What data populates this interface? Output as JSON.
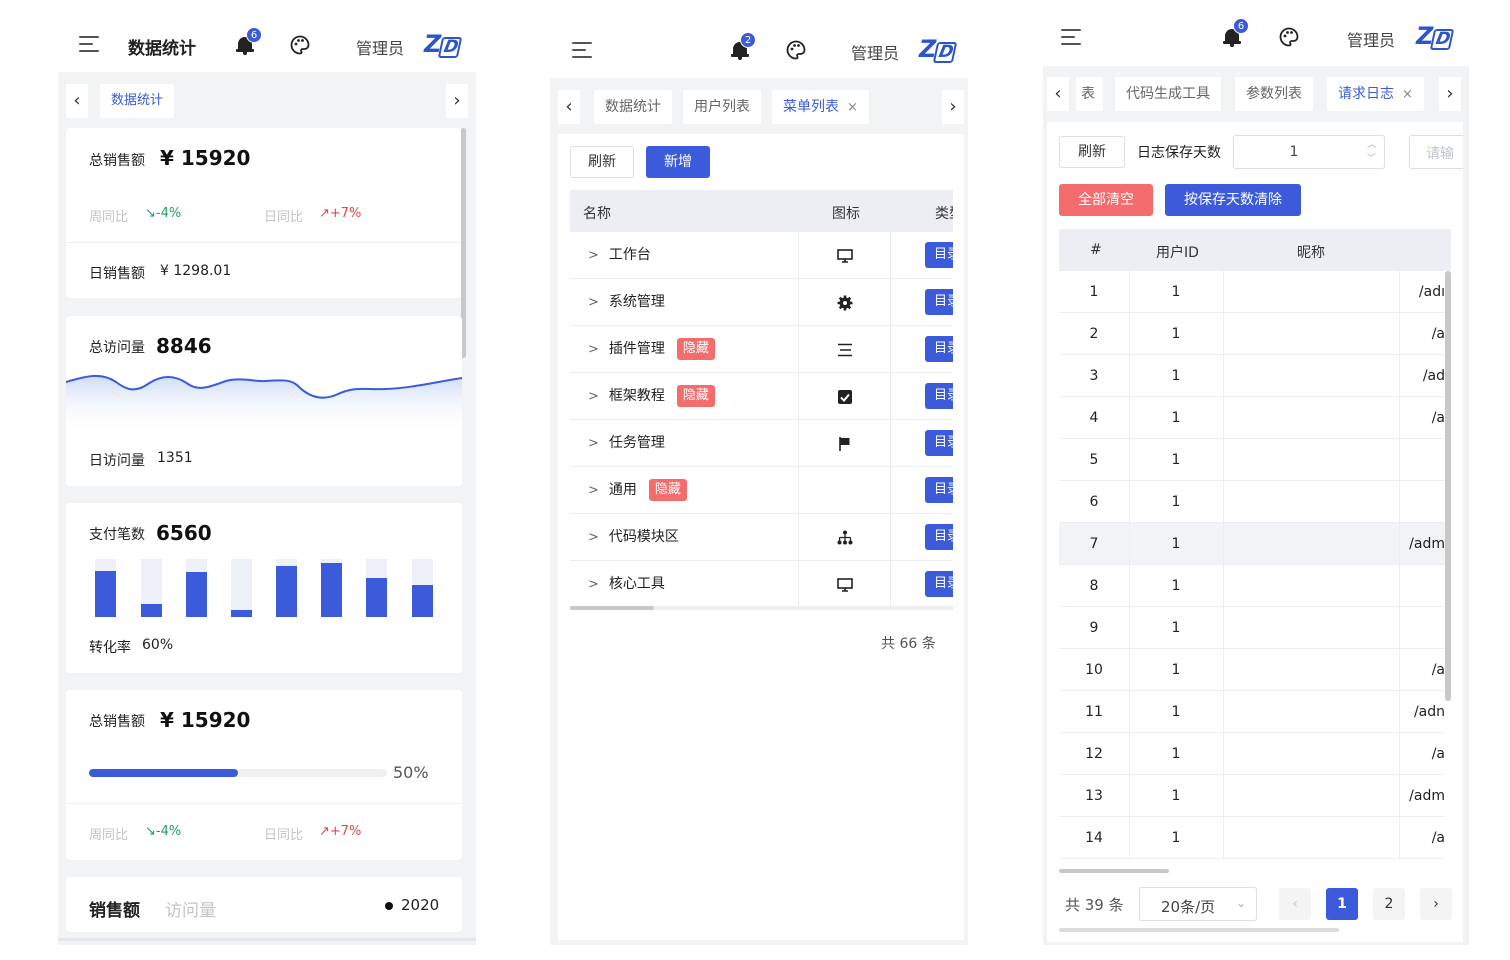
{
  "screen1": {
    "header": {
      "title": "数据统计",
      "badge": "6",
      "admin": "管理员",
      "logo": "Z",
      "logo_box": "D"
    },
    "tabs": {
      "left": "‹",
      "right": "›",
      "active": "数据统计"
    },
    "card1": {
      "label": "总销售额",
      "value": "¥ 15920",
      "wow_label": "周同比",
      "wow_value": "↘-4%",
      "dod_label": "日同比",
      "dod_value": "↗+7%",
      "daily_label": "日销售额",
      "daily_value": "¥ 1298.01"
    },
    "card2": {
      "label": "总访问量",
      "value": "8846",
      "daily_label": "日访问量",
      "daily_value": "1351"
    },
    "card3": {
      "label": "支付笔数",
      "value": "6560",
      "rate_label": "转化率",
      "rate_value": "60%",
      "bars": [
        0.8,
        0.22,
        0.78,
        0.12,
        0.88,
        0.93,
        0.68,
        0.55
      ]
    },
    "card4": {
      "label": "总销售额",
      "value": "¥ 15920",
      "progress": 0.5,
      "progress_text": "50%",
      "wow_label": "周同比",
      "wow_value": "↘-4%",
      "dod_label": "日同比",
      "dod_value": "↗+7%"
    },
    "card5": {
      "tab_sales": "销售额",
      "tab_visits": "访问量",
      "year": "2020"
    }
  },
  "screen2": {
    "header": {
      "badge": "2",
      "admin": "管理员",
      "logo": "Z",
      "logo_box": "D"
    },
    "tabs": {
      "left": "‹",
      "right": "›",
      "items": [
        "数据统计",
        "用户列表",
        "菜单列表"
      ],
      "close": "×"
    },
    "toolbar": {
      "refresh": "刷新",
      "add": "新增"
    },
    "table": {
      "headers": {
        "name": "名称",
        "icon": "图标",
        "type": "类型"
      },
      "hidden_tag": "隐藏",
      "type_tag": "目录",
      "rows": [
        {
          "name": "工作台",
          "icon": "monitor-icon",
          "hidden": false
        },
        {
          "name": "系统管理",
          "icon": "gear-icon",
          "hidden": false
        },
        {
          "name": "插件管理",
          "icon": "list-icon",
          "hidden": true
        },
        {
          "name": "框架教程",
          "icon": "checkbox-icon",
          "hidden": true
        },
        {
          "name": "任务管理",
          "icon": "flag-icon",
          "hidden": false
        },
        {
          "name": "通用",
          "icon": "",
          "hidden": true
        },
        {
          "name": "代码模块区",
          "icon": "sitemap-icon",
          "hidden": false
        },
        {
          "name": "核心工具",
          "icon": "monitor-icon",
          "hidden": false
        }
      ]
    },
    "total": "共 66 条"
  },
  "screen3": {
    "header": {
      "badge": "6",
      "admin": "管理员",
      "logo": "Z",
      "logo_box": "D"
    },
    "tabs": {
      "left": "‹",
      "right": "›",
      "items": [
        "表",
        "代码生成工具",
        "参数列表",
        "请求日志"
      ],
      "close": "×"
    },
    "toolbar": {
      "refresh": "刷新",
      "days_label": "日志保存天数",
      "days_value": "1",
      "placeholder_cut": "请输",
      "clear_all": "全部清空",
      "clear_by_days": "按保存天数清除"
    },
    "table": {
      "headers": {
        "index": "#",
        "user_id": "用户ID",
        "nickname": "昵称"
      },
      "rows": [
        {
          "i": "1",
          "uid": "1",
          "path": "/adı"
        },
        {
          "i": "2",
          "uid": "1",
          "path": "/a"
        },
        {
          "i": "3",
          "uid": "1",
          "path": "/ad"
        },
        {
          "i": "4",
          "uid": "1",
          "path": "/a"
        },
        {
          "i": "5",
          "uid": "1",
          "path": ""
        },
        {
          "i": "6",
          "uid": "1",
          "path": ""
        },
        {
          "i": "7",
          "uid": "1",
          "path": "/adm"
        },
        {
          "i": "8",
          "uid": "1",
          "path": ""
        },
        {
          "i": "9",
          "uid": "1",
          "path": ""
        },
        {
          "i": "10",
          "uid": "1",
          "path": "/a"
        },
        {
          "i": "11",
          "uid": "1",
          "path": "/adn"
        },
        {
          "i": "12",
          "uid": "1",
          "path": "/a"
        },
        {
          "i": "13",
          "uid": "1",
          "path": "/adm"
        },
        {
          "i": "14",
          "uid": "1",
          "path": "/a"
        }
      ]
    },
    "pagination": {
      "total": "共 39 条",
      "page_size": "20条/页",
      "prev": "‹",
      "next": "›",
      "pages": [
        "1",
        "2"
      ]
    }
  }
}
